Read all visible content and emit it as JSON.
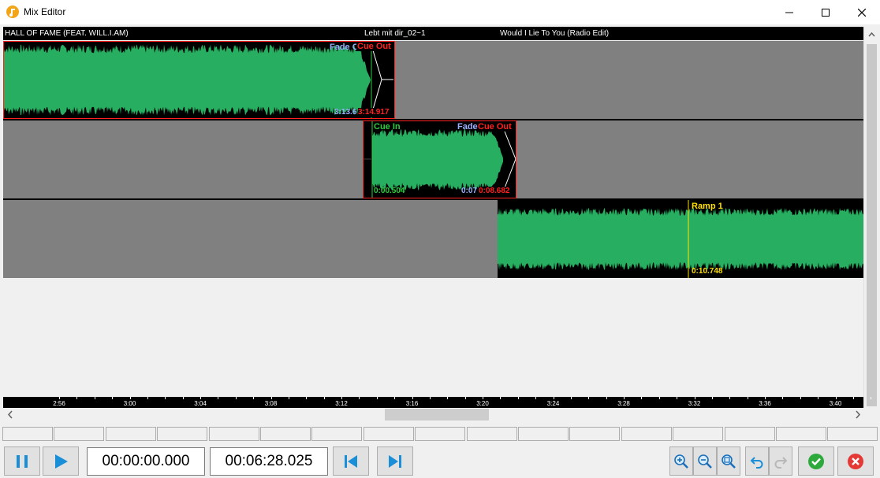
{
  "window": {
    "title": "Mix Editor"
  },
  "tracks": [
    {
      "title": "HALL OF FAME (FEAT. WILL.I.AM)"
    },
    {
      "title": "Lebt mit dir_02~1"
    },
    {
      "title": "Would I Lie To You (Radio Edit)"
    }
  ],
  "clip1": {
    "fade_label": "Fade C",
    "cue_out_label": "Cue Out",
    "fade_time": "3:13.6",
    "cue_out_time": "3:14.917"
  },
  "clip2": {
    "cue_in_label": "Cue In",
    "fade_label": "Fade",
    "cue_out_label": "Cue Out",
    "cue_in_time": "0:00.504",
    "fade_time": "0:07",
    "cue_out_time": "0:08.682"
  },
  "clip3": {
    "ramp_label": "Ramp 1",
    "ramp_time": "0:10.748"
  },
  "timeline": {
    "ticks": [
      "2:56",
      "3:00",
      "3:04",
      "3:08",
      "3:12",
      "3:16",
      "3:20",
      "3:24",
      "3:28",
      "3:32",
      "3:36",
      "3:40"
    ]
  },
  "transport": {
    "position": "00:00:00.000",
    "duration": "00:06:28.025"
  },
  "icons": {
    "pause": "pause-icon",
    "play": "play-icon",
    "skip_start": "skip-to-start-icon",
    "skip_end": "skip-to-end-icon",
    "zoom_in": "zoom-in-icon",
    "zoom_out": "zoom-out-icon",
    "zoom_fit": "zoom-fit-icon",
    "undo": "undo-icon",
    "redo": "redo-icon",
    "ok": "check-icon",
    "cancel": "close-icon"
  },
  "colors": {
    "waveform": "#27ae60",
    "cue_in": "#2ecc40",
    "cue_out": "#ff2020",
    "ramp": "#ffe000",
    "fade": "#9ab0ff",
    "accent": "#1a8fd8"
  }
}
